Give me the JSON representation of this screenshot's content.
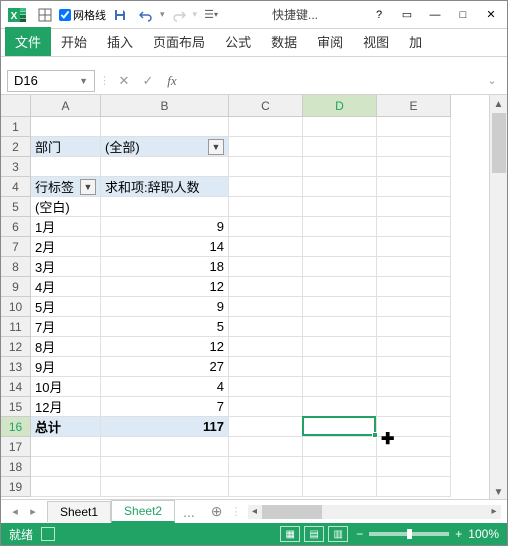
{
  "titlebar": {
    "gridlines_label": "网格线",
    "shortcut_label": "快捷键...",
    "gridlines_checked": true
  },
  "ribbon": {
    "file": "文件",
    "home": "开始",
    "insert": "插入",
    "layout": "页面布局",
    "formulas": "公式",
    "data": "数据",
    "review": "审阅",
    "view": "视图",
    "addins": "加"
  },
  "namebox": {
    "value": "D16"
  },
  "cols": {
    "A": "A",
    "B": "B",
    "C": "C",
    "D": "D",
    "E": "E"
  },
  "col_widths": {
    "A": 70,
    "B": 128,
    "C": 74,
    "D": 74,
    "E": 74
  },
  "pivot": {
    "filter_field": "部门",
    "filter_value": "(全部)",
    "row_label_header": "行标签",
    "value_header": "求和项:辞职人数",
    "rows": [
      {
        "label": "(空白)",
        "value": ""
      },
      {
        "label": "1月",
        "value": "9"
      },
      {
        "label": "2月",
        "value": "14"
      },
      {
        "label": "3月",
        "value": "18"
      },
      {
        "label": "4月",
        "value": "12"
      },
      {
        "label": "5月",
        "value": "9"
      },
      {
        "label": "7月",
        "value": "5"
      },
      {
        "label": "8月",
        "value": "12"
      },
      {
        "label": "9月",
        "value": "27"
      },
      {
        "label": "10月",
        "value": "4"
      },
      {
        "label": "12月",
        "value": "7"
      }
    ],
    "total_label": "总计",
    "total_value": "117"
  },
  "sheets": {
    "sheet1": "Sheet1",
    "sheet2": "Sheet2",
    "more": "..."
  },
  "status": {
    "ready": "就绪",
    "zoom": "100%"
  },
  "active_cell": {
    "col": "D",
    "row": 16
  }
}
